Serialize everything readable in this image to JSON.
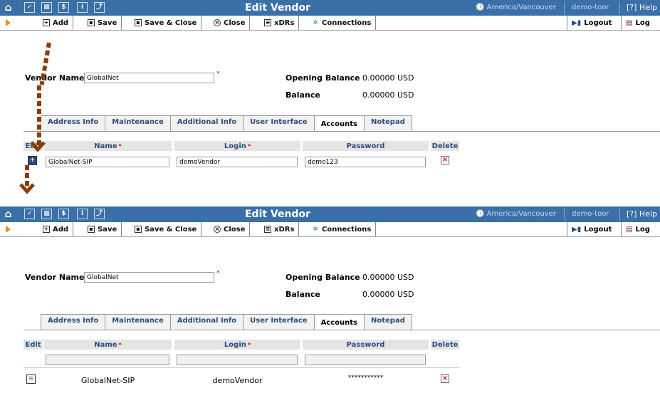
{
  "window": {
    "title": "Edit Vendor",
    "timezone": "America/Vancouver",
    "user": "demo-toor",
    "help_label": "Help"
  },
  "toolbar": {
    "add": "Add",
    "save": "Save",
    "save_close": "Save & Close",
    "close": "Close",
    "xdrs": "xDRs",
    "connections": "Connections",
    "logout": "Logout",
    "log": "Log"
  },
  "form": {
    "vendor_name_label": "Vendor Name",
    "vendor_name_value": "GlobalNet",
    "opening_balance_label": "Opening Balance",
    "opening_balance_value": "0.00000 USD",
    "balance_label": "Balance",
    "balance_value": "0.00000 USD"
  },
  "tabs": [
    "Address Info",
    "Maintenance",
    "Additional Info",
    "User Interface",
    "Accounts",
    "Notepad"
  ],
  "grid": {
    "headers": {
      "edit": "Edit",
      "name": "Name",
      "login": "Login",
      "password": "Password",
      "delete": "Delete"
    },
    "edit_row": {
      "name": "GlobalNet-SIP",
      "login": "demoVendor",
      "password": "demo123"
    },
    "saved_row": {
      "name": "GlobalNet-SIP",
      "login": "demoVendor",
      "password": "***********"
    }
  },
  "colors": {
    "topbar": "#3b6fa8",
    "tab_text": "#2b4f7d",
    "arrow": "#8b3a0a"
  }
}
